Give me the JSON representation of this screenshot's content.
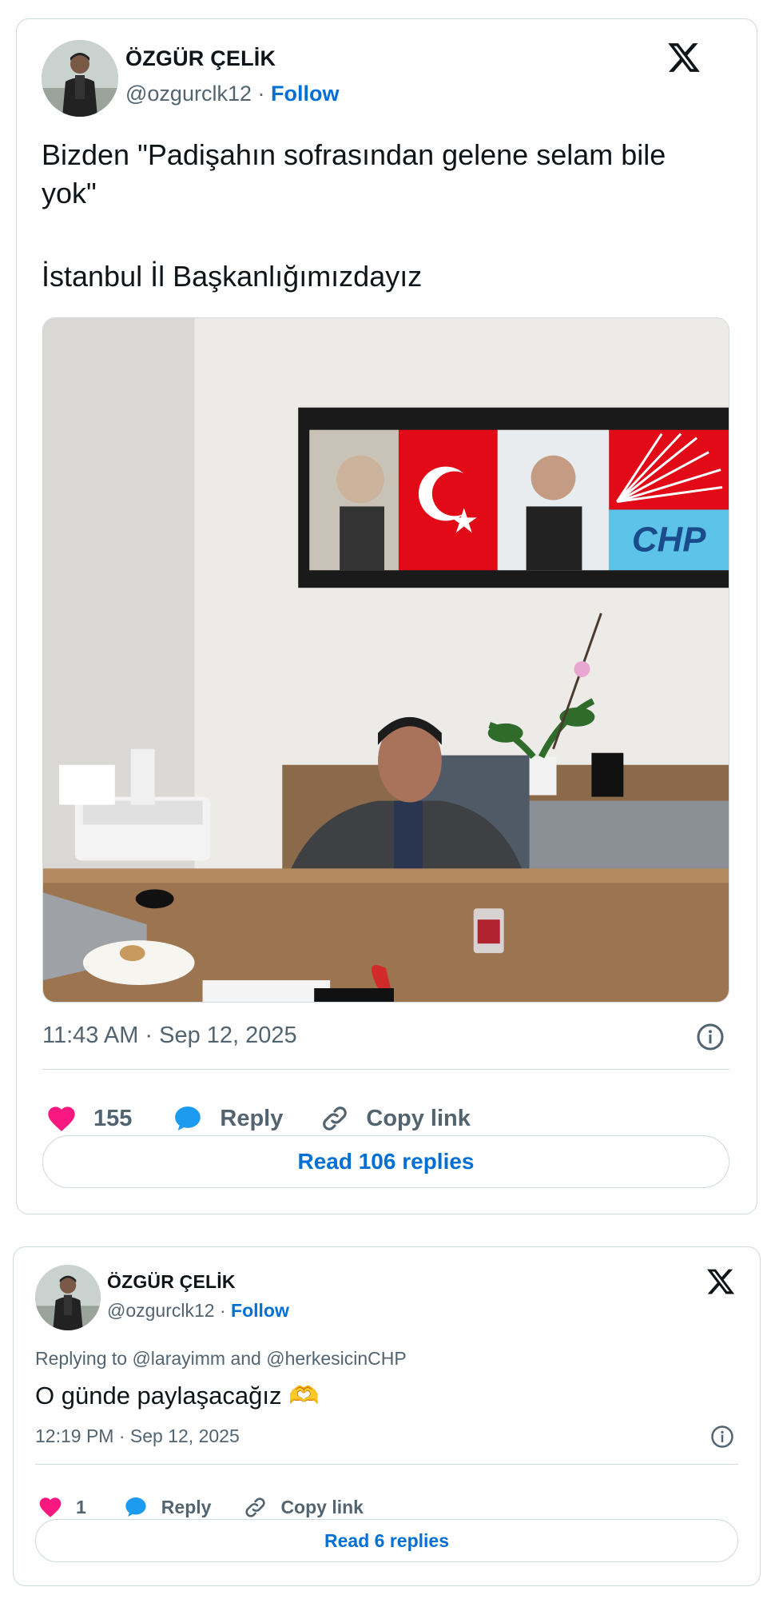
{
  "tweets": [
    {
      "author": {
        "name": "ÖZGÜR ÇELİK",
        "handle": "@ozgurclk12",
        "separator": "·",
        "follow": "Follow"
      },
      "text_line1": "Bizden \"Padişahın sofrasından gelene selam bile yok\"",
      "text_line2": "İstanbul İl Başkanlığımızdayız",
      "photo_sign": "CHP",
      "timestamp": "11:43 AM · Sep 12, 2025",
      "like_count": "155",
      "reply_label": "Reply",
      "copy_label": "Copy link",
      "read_replies": "Read 106 replies"
    },
    {
      "author": {
        "name": "ÖZGÜR ÇELİK",
        "handle": "@ozgurclk12",
        "separator": "·",
        "follow": "Follow"
      },
      "replying_to": "Replying to @larayimm and @herkesicinCHP",
      "text": "O günde paylaşacağız 🫶",
      "timestamp": "12:19 PM · Sep 12, 2025",
      "like_count": "1",
      "reply_label": "Reply",
      "copy_label": "Copy link",
      "read_replies": "Read 6 replies"
    }
  ],
  "colors": {
    "like": "#f91880",
    "reply": "#1d9bf0",
    "link": "#006fd6",
    "muted": "#536471",
    "border": "#cfd9de"
  },
  "icons": [
    "avatar",
    "x-logo-icon",
    "info-icon",
    "heart-icon",
    "reply-bubble-icon",
    "link-icon"
  ]
}
